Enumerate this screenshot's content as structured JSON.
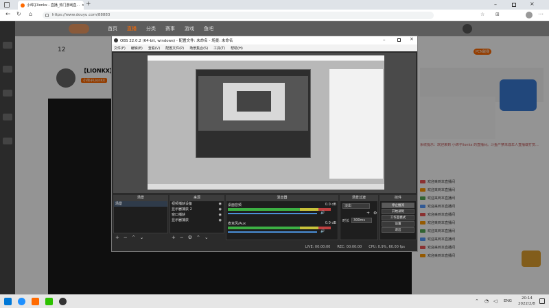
{
  "browser": {
    "tab_title": "小绵子lionkx - 直播_热门游戏直...",
    "url": "https://www.douyu.com/88883"
  },
  "douyu": {
    "nav": [
      "首页",
      "直播",
      "分类",
      "赛事",
      "游戏",
      "鱼吧"
    ],
    "follow_count": "12",
    "streamer_name": "【LIONKX】上",
    "streamer_tag": "小绵子LionKX",
    "pcn_badge": "PCN联赛"
  },
  "obs": {
    "title": "OBS 22.0.2 (64-bit, windows) - 配置文件: 未命名 - 场景: 未命名",
    "menu": [
      "文件(F)",
      "编辑(E)",
      "查看(V)",
      "配置文件(P)",
      "场景集合(S)",
      "工具(T)",
      "帮助(H)"
    ],
    "scenes_title": "场景",
    "scene_item": "场景",
    "sources_title": "来源",
    "sources": [
      "视频捕获设备",
      "显示器捕获 2",
      "窗口捕获",
      "显示器捕获"
    ],
    "mixer_title": "混音器",
    "mixer_tracks": [
      {
        "name": "桌面音频",
        "db": "0.0 dB"
      },
      {
        "name": "麦克风/Aux",
        "db": "0.0 dB"
      }
    ],
    "transitions_title": "场景过渡",
    "transition_type": "淡出",
    "duration_label": "时长",
    "duration_value": "300ms",
    "controls_title": "控件",
    "controls": [
      "停止推流",
      "开始录制",
      "工作室模式",
      "设置",
      "退出"
    ],
    "status_live": "LIVE: 00:00:00",
    "status_rec": "REC: 00:00:00",
    "status_cpu": "CPU: 0.9%, 60.00 fps"
  },
  "chat": {
    "welcome": "系统提示：欢迎来到 小绵子lionkx 的直播间。斗鱼严禁未成年人直播或打赏...",
    "lines": [
      "欢迎来到本直播间",
      "欢迎来到本直播间",
      "欢迎来到本直播间",
      "欢迎来到本直播间",
      "欢迎来到本直播间",
      "欢迎来到本直播间",
      "欢迎来到本直播间",
      "欢迎来到本直播间",
      "欢迎来到本直播间",
      "欢迎来到本直播间"
    ]
  },
  "taskbar": {
    "lang": "ENG",
    "time": "20:14",
    "date": "2022/2/8"
  },
  "colors": {
    "douyu_orange": "#ff6a00",
    "obs_bg": "#2b2b2b",
    "meter_green": "#3cb043"
  }
}
